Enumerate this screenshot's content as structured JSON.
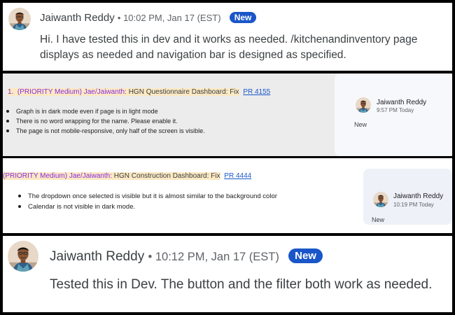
{
  "panel1": {
    "author": "Jaiwanth Reddy",
    "meta": "• 10:02 PM, Jan 17 (EST)",
    "badge": "New",
    "message": "Hi. I have tested this in dev and it works as needed. /kitchenandinventory page displays as needed and navigation bar is designed as specified."
  },
  "panel2": {
    "number": "1.",
    "priority": "(PRIORITY Medium)",
    "assignees": "Jae/Jaiwanth:",
    "task": "HGN Questionnaire Dashboard: Fix",
    "pr": "PR 4155",
    "issues": [
      "Graph is in dark mode even if page is in light mode",
      "There is no word wrapping for the name. Please enable it.",
      "The page is not mobile-responsive, only half of the screen is visible."
    ],
    "card": {
      "author": "Jaiwanth Reddy",
      "time": "9:57 PM Today",
      "status": "New"
    }
  },
  "panel3": {
    "priority": "(PRIORITY Medium)",
    "assignees": "Jae/Jaiwanth:",
    "task": "HGN Construction Dashboard: Fix",
    "pr": "PR 4444",
    "issues": [
      "The dropdown once selected is visible but it is almost similar to the background color",
      "Calendar is not visible in dark mode."
    ],
    "card": {
      "author": "Jaiwanth Reddy",
      "time": "10:19 PM Today",
      "status": "New"
    }
  },
  "panel4": {
    "author": "Jaiwanth Reddy",
    "meta": "• 10:12 PM, Jan 17 (EST)",
    "badge": "New",
    "message": "Tested this in Dev. The button and the filter both work as needed."
  },
  "colors": {
    "badge": "#1a56c9",
    "link": "#1a56c9",
    "priority": "#8a2be2",
    "highlight": "#fbe9c3"
  }
}
